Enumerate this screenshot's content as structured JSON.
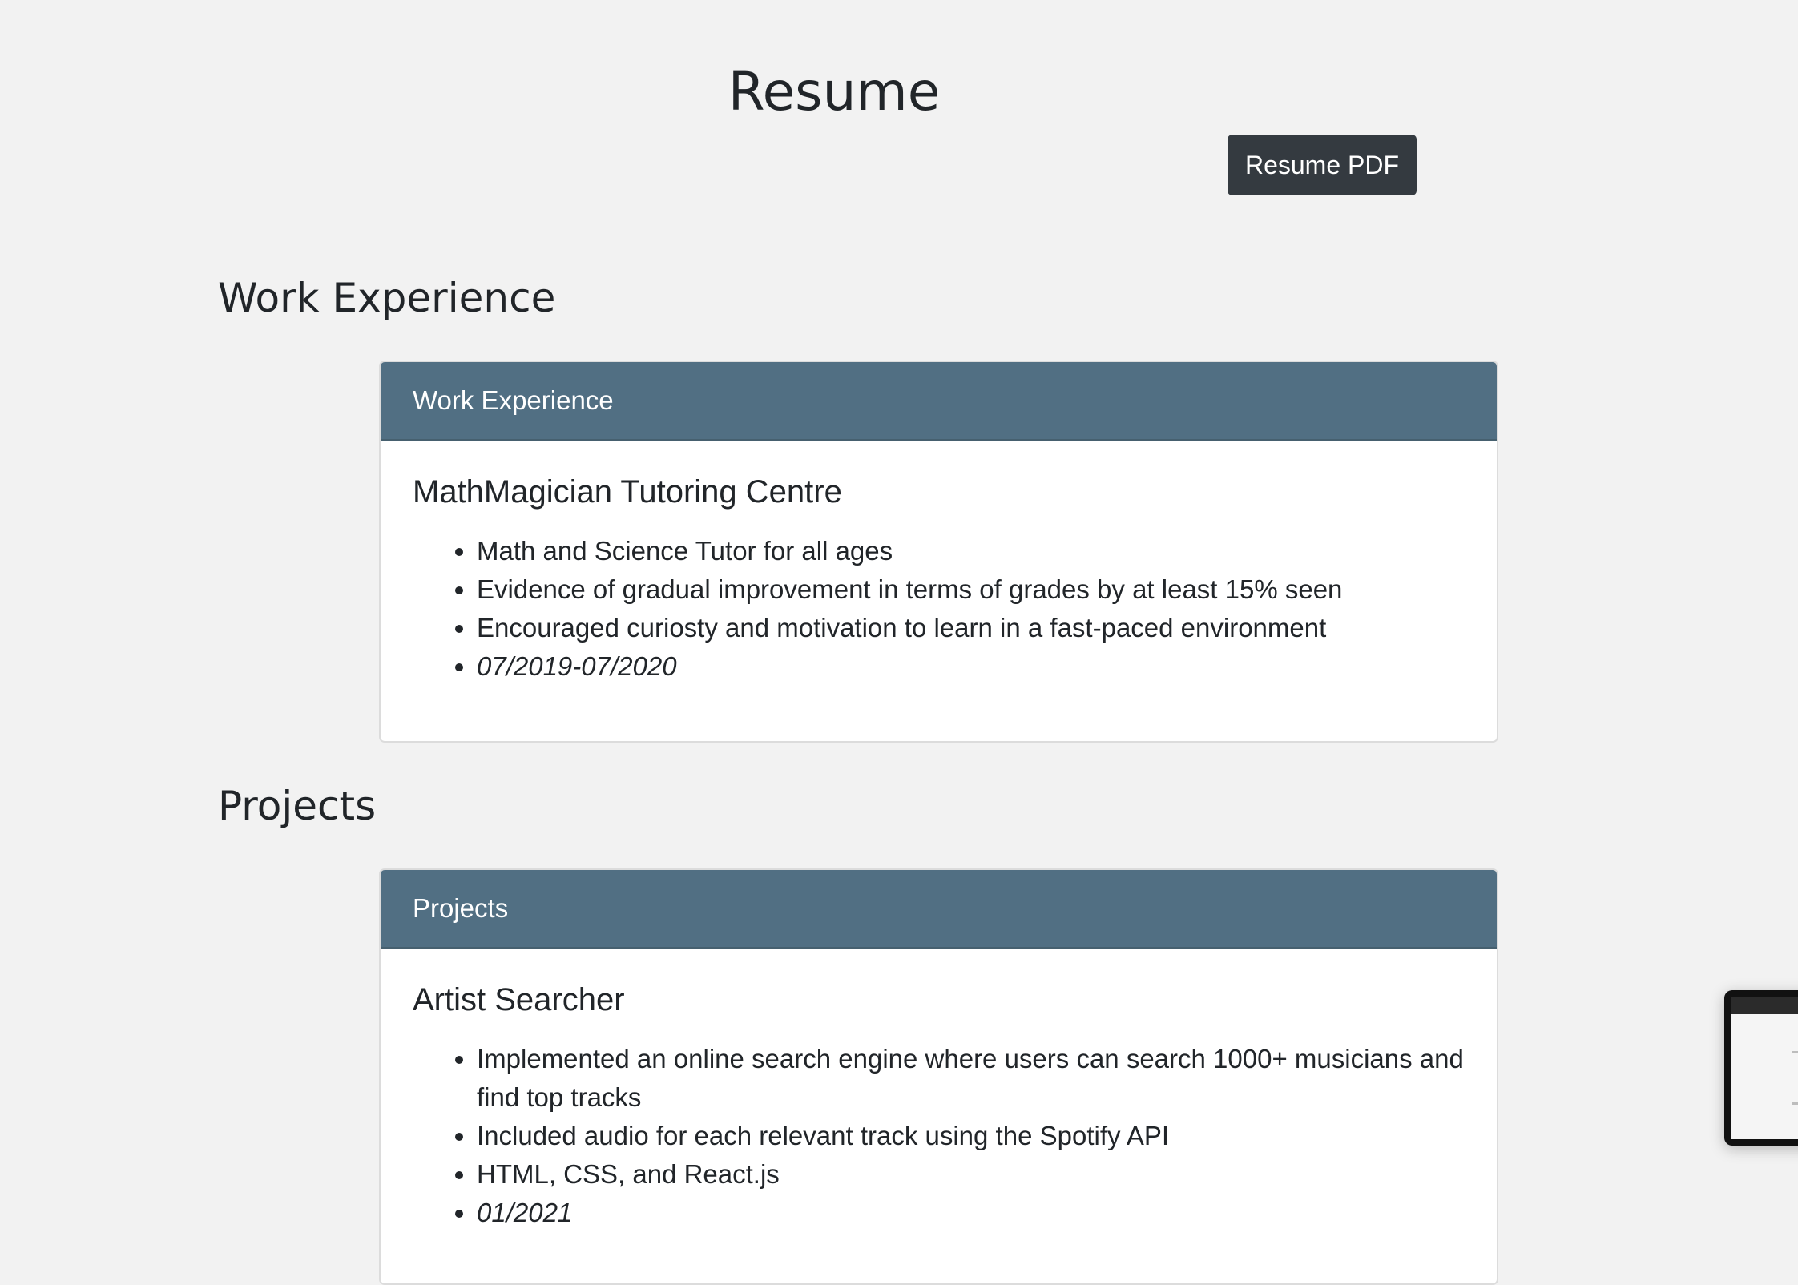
{
  "page": {
    "title": "Resume",
    "pdf_button_label": "Resume PDF"
  },
  "work_section": {
    "heading": "Work Experience",
    "card_header": "Work Experience",
    "entries": [
      {
        "title": "MathMagician Tutoring Centre",
        "bullets": [
          "Math and Science Tutor for all ages",
          "Evidence of gradual improvement in terms of grades by at least 15% seen",
          "Encouraged curiosty and motivation to learn in a fast-paced environment"
        ],
        "date": "07/2019-07/2020"
      }
    ]
  },
  "projects_section": {
    "heading": "Projects",
    "card_header": "Projects",
    "entries": [
      {
        "title": "Artist Searcher",
        "bullets": [
          "Implemented an online search engine where users can search 1000+ musicians and find top tracks",
          "Included audio for each relevant track using the Spotify API",
          "HTML, CSS, and React.js"
        ],
        "date": "01/2021"
      }
    ]
  },
  "colors": {
    "background": "#f2f2f2",
    "card_header": "#516f83",
    "button": "#343a40",
    "text": "#212529"
  },
  "icons": {
    "screenshot_thumbnail": "window-thumbnail-icon"
  }
}
